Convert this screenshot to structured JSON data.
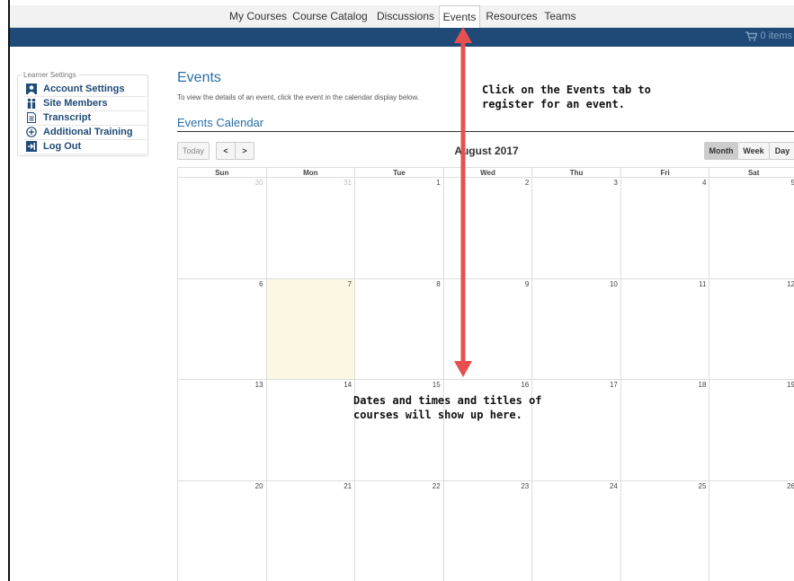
{
  "topnav": {
    "items": [
      {
        "label": "My Courses"
      },
      {
        "label": "Course Catalog"
      },
      {
        "label": "Discussions"
      },
      {
        "label": "Events"
      },
      {
        "label": "Resources"
      },
      {
        "label": "Teams"
      }
    ]
  },
  "cart": {
    "label": "0 items"
  },
  "sidebar": {
    "legend": "Learner Settings",
    "items": [
      {
        "label": "Account Settings",
        "icon": "user-icon"
      },
      {
        "label": "Site Members",
        "icon": "people-icon"
      },
      {
        "label": "Transcript",
        "icon": "document-icon"
      },
      {
        "label": "Additional Training",
        "icon": "plus-circle-icon"
      },
      {
        "label": "Log Out",
        "icon": "logout-icon"
      }
    ]
  },
  "main": {
    "title": "Events",
    "description": "To view the details of an event, click the event in the calendar display below.",
    "calendar_title": "Events Calendar"
  },
  "calendar": {
    "today_label": "Today",
    "prev_label": "<",
    "next_label": ">",
    "month_label": "August 2017",
    "view_month": "Month",
    "view_week": "Week",
    "view_day": "Day",
    "weekdays": [
      "Sun",
      "Mon",
      "Tue",
      "Wed",
      "Thu",
      "Fri",
      "Sat"
    ],
    "weeks": [
      [
        "30",
        "31",
        "1",
        "2",
        "3",
        "4",
        "5"
      ],
      [
        "6",
        "7",
        "8",
        "9",
        "10",
        "11",
        "12"
      ],
      [
        "13",
        "14",
        "15",
        "16",
        "17",
        "18",
        "19"
      ],
      [
        "20",
        "21",
        "22",
        "23",
        "24",
        "25",
        "26"
      ]
    ]
  },
  "annotations": {
    "top_note_line1": "Click on the Events tab to",
    "top_note_line2": "register for an event.",
    "mid_note_line1": "Dates and times and titles of",
    "mid_note_line2": "courses will show up here."
  },
  "colors": {
    "accent_blue": "#1f4a77",
    "link_blue": "#2a6fa8",
    "arrow_red": "#e8504f",
    "today_highlight": "#fcf8e3"
  }
}
